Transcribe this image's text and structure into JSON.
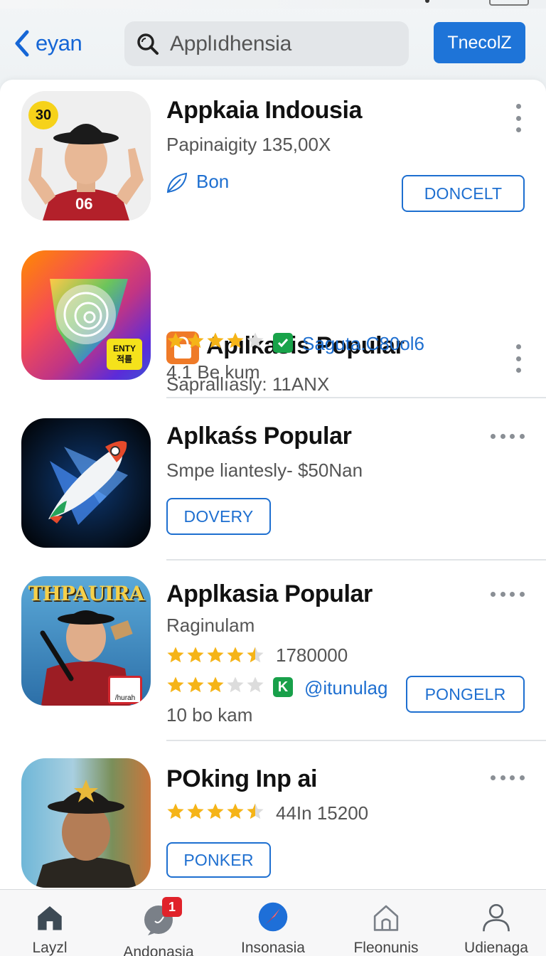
{
  "header": {
    "back_label": "eyan",
    "search_text": "Applıdhensia",
    "action_label": "TnecolZ"
  },
  "apps": [
    {
      "title": "Appkaia Indousia",
      "subtitle": "Papinaigity 135,00X",
      "publisher": "Bon",
      "button_label": "DONCELT",
      "icon_badge": "30",
      "icon_shirt_text": "06"
    },
    {
      "title": "Apılkasis Popular",
      "subtitle": "Saprallıasly: 11ANX",
      "rating": 4,
      "verified_text": "Saguta.C80ol6",
      "reviews": "4.1 Be kum",
      "icon_badge": "ENTY\n적를"
    },
    {
      "title": "Aplkaśs Popular",
      "subtitle": "Smpe liantesly- $50Nan",
      "button_label": "DOVERY"
    },
    {
      "title": "Applkasia Popular",
      "subtitle": "Raginulam",
      "rating_primary": 4.5,
      "rating_primary_text": "1780000",
      "rating_secondary": 3,
      "link_text": "@itunulag",
      "k_badge": "K",
      "reviews": "10 bo kam",
      "button_label": "PONGELR",
      "icon_banner": "THPAUIRA",
      "icon_sticker": "/hurah"
    },
    {
      "title": "POking Inp ai",
      "rating": 4.5,
      "rating_text": "44In 15200",
      "button_label": "PONKER"
    }
  ],
  "tabbar": {
    "tabs": [
      {
        "label": "Layzl",
        "icon": "home-icon"
      },
      {
        "label": "Andonasia",
        "icon": "chat-icon",
        "badge": "1"
      },
      {
        "label": "Insonasia",
        "icon": "compass-icon"
      },
      {
        "label": "Fleonunis",
        "icon": "house-outline-icon"
      },
      {
        "label": "Udienaga",
        "icon": "person-icon"
      }
    ]
  },
  "colors": {
    "accent": "#1e6fd0",
    "star": "#f5b418",
    "badge": "#e0222a"
  }
}
